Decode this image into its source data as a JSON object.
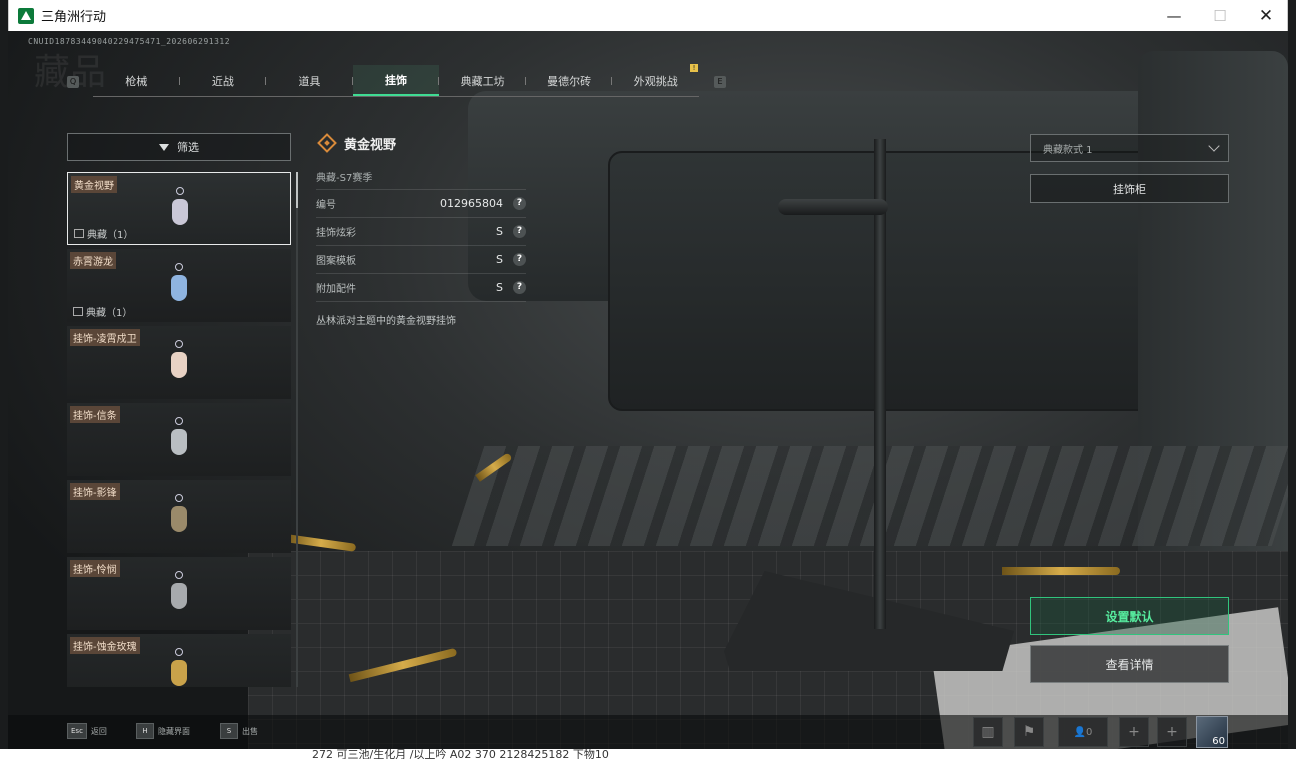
{
  "window": {
    "title": "三角洲行动"
  },
  "header": {
    "cnuid": "CNUID18783449040229475471_202606291312",
    "heading": "藏品",
    "q_key": "Q",
    "e_key": "E",
    "tab_badge": "!",
    "tabs": [
      {
        "label": "枪械"
      },
      {
        "label": "近战"
      },
      {
        "label": "道具"
      },
      {
        "label": "挂饰",
        "active": true
      },
      {
        "label": "典藏工坊"
      },
      {
        "label": "曼德尔砖"
      },
      {
        "label": "外观挑战"
      }
    ]
  },
  "filter": {
    "label": "筛选"
  },
  "items": [
    {
      "name": "黄金视野",
      "tag": "典藏（1）",
      "color": "#c9c7d6",
      "selected": true
    },
    {
      "name": "赤霄游龙",
      "tag": "典藏（1）",
      "color": "#8fb4e0"
    },
    {
      "name": "挂饰-凌霄戍卫",
      "tag": "",
      "color": "#e8d2c4"
    },
    {
      "name": "挂饰-信条",
      "tag": "",
      "color": "#b9bec2"
    },
    {
      "name": "挂饰-影锋",
      "tag": "",
      "color": "#9a8a6a"
    },
    {
      "name": "挂饰-怜悯",
      "tag": "",
      "color": "#a7aaad"
    },
    {
      "name": "挂饰-蚀金玫瑰",
      "tag": "",
      "color": "#c9a24a"
    }
  ],
  "detail": {
    "title": "黄金视野",
    "season": "典藏-S7赛季",
    "rows": [
      {
        "label": "编号",
        "value": "012965804"
      },
      {
        "label": "挂饰炫彩",
        "value": "S"
      },
      {
        "label": "图案模板",
        "value": "S"
      },
      {
        "label": "附加配件",
        "value": "S"
      }
    ],
    "help": "?",
    "description": "丛林派对主题中的黄金视野挂饰"
  },
  "right": {
    "style_select": "典藏款式 1",
    "cabinet_button": "挂饰柜",
    "set_default_button": "设置默认",
    "details_button": "查看详情",
    "accent_color": "#3fdc93"
  },
  "bottom": {
    "hints": [
      {
        "key": "Esc",
        "label": "返回"
      },
      {
        "key": "H",
        "label": "隐藏界面"
      },
      {
        "key": "S",
        "label": "出售"
      }
    ],
    "friends_count": "0",
    "add_slot": "+",
    "avatar_level": "60",
    "icons": [
      "stats-icon",
      "flag-icon",
      "friends-icon"
    ]
  },
  "background_strip": "272  可三池/生化月 /以上吟                                     A02        370        2128425182    下物10"
}
